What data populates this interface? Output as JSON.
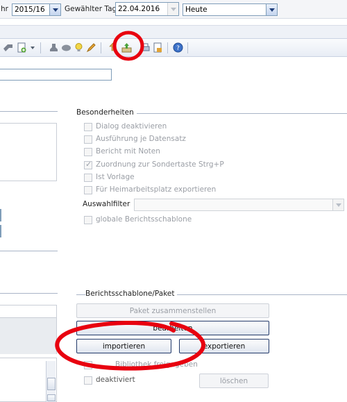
{
  "top": {
    "jahr_label_partial": "hr",
    "jahr_value": "2015/16",
    "tag_label": "Gewählter Tag",
    "tag_value": "22.04.2016",
    "heute_value": "Heute"
  },
  "besonderheiten": {
    "title": "Besonderheiten",
    "items": [
      {
        "label": "Dialog deaktivieren",
        "checked": false
      },
      {
        "label": "Ausführung je Datensatz",
        "checked": false
      },
      {
        "label": "Bericht mit Noten",
        "checked": false
      },
      {
        "label": "Zuordnung zur Sondertaste Strg+P",
        "checked": true
      },
      {
        "label": "Ist Vorlage",
        "checked": false
      },
      {
        "label": "Für Heimarbeitsplatz exportieren",
        "checked": false
      }
    ],
    "auswahlfilter_label": "Auswahlfilter",
    "auswahlfilter_value": "",
    "globale_label": "globale Berichtsschablone"
  },
  "paket": {
    "title": "Berichtsschablone/Paket",
    "zusammenstellen_label": "Paket zusammenstellen",
    "bearbeiten_label": "bearbeiten",
    "importieren_label": "importieren",
    "exportieren_label": "exportieren",
    "bibliothek_label": "Bibliothek freigegeben",
    "deaktiviert_label": "deaktiviert",
    "loeschen_label": "löschen"
  },
  "annotations": {
    "color": "#e8000f"
  }
}
